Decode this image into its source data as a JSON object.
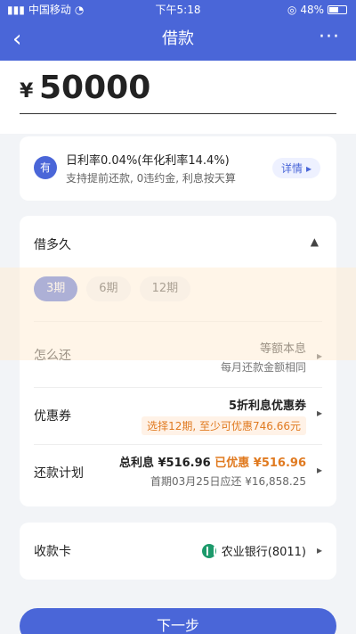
{
  "statusbar": {
    "carrier": "中国移动",
    "time": "下午5:18",
    "battery": "48%"
  },
  "navbar": {
    "title": "借款"
  },
  "amount": {
    "currency_symbol": "¥",
    "value": "50000"
  },
  "rate": {
    "icon_text": "有",
    "title": "日利率0.04%(年化利率14.4%)",
    "subtitle": "支持提前还款, 0违约金, 利息按天算",
    "detail_label": "详情"
  },
  "duration": {
    "label": "借多久",
    "options": [
      {
        "label": "3期",
        "active": true
      },
      {
        "label": "6期",
        "active": false
      },
      {
        "label": "12期",
        "active": false
      }
    ]
  },
  "repay_method": {
    "label": "怎么还",
    "main": "等额本息",
    "sub": "每月还款金额相同"
  },
  "coupon": {
    "label": "优惠券",
    "main": "5折利息优惠券",
    "sub": "选择12期, 至少可优惠746.66元"
  },
  "plan": {
    "label": "还款计划",
    "total_interest_prefix": "总利息 ¥516.96",
    "discount_text": "已优惠 ¥516.96",
    "sub": "首期03月25日应还 ¥16,858.25"
  },
  "receive_card": {
    "label": "收款卡",
    "bank": "农业银行(8011)"
  },
  "next_button": {
    "label": "下一步"
  },
  "colors": {
    "brand": "#4a66d8",
    "accent_orange": "#e07a20"
  }
}
